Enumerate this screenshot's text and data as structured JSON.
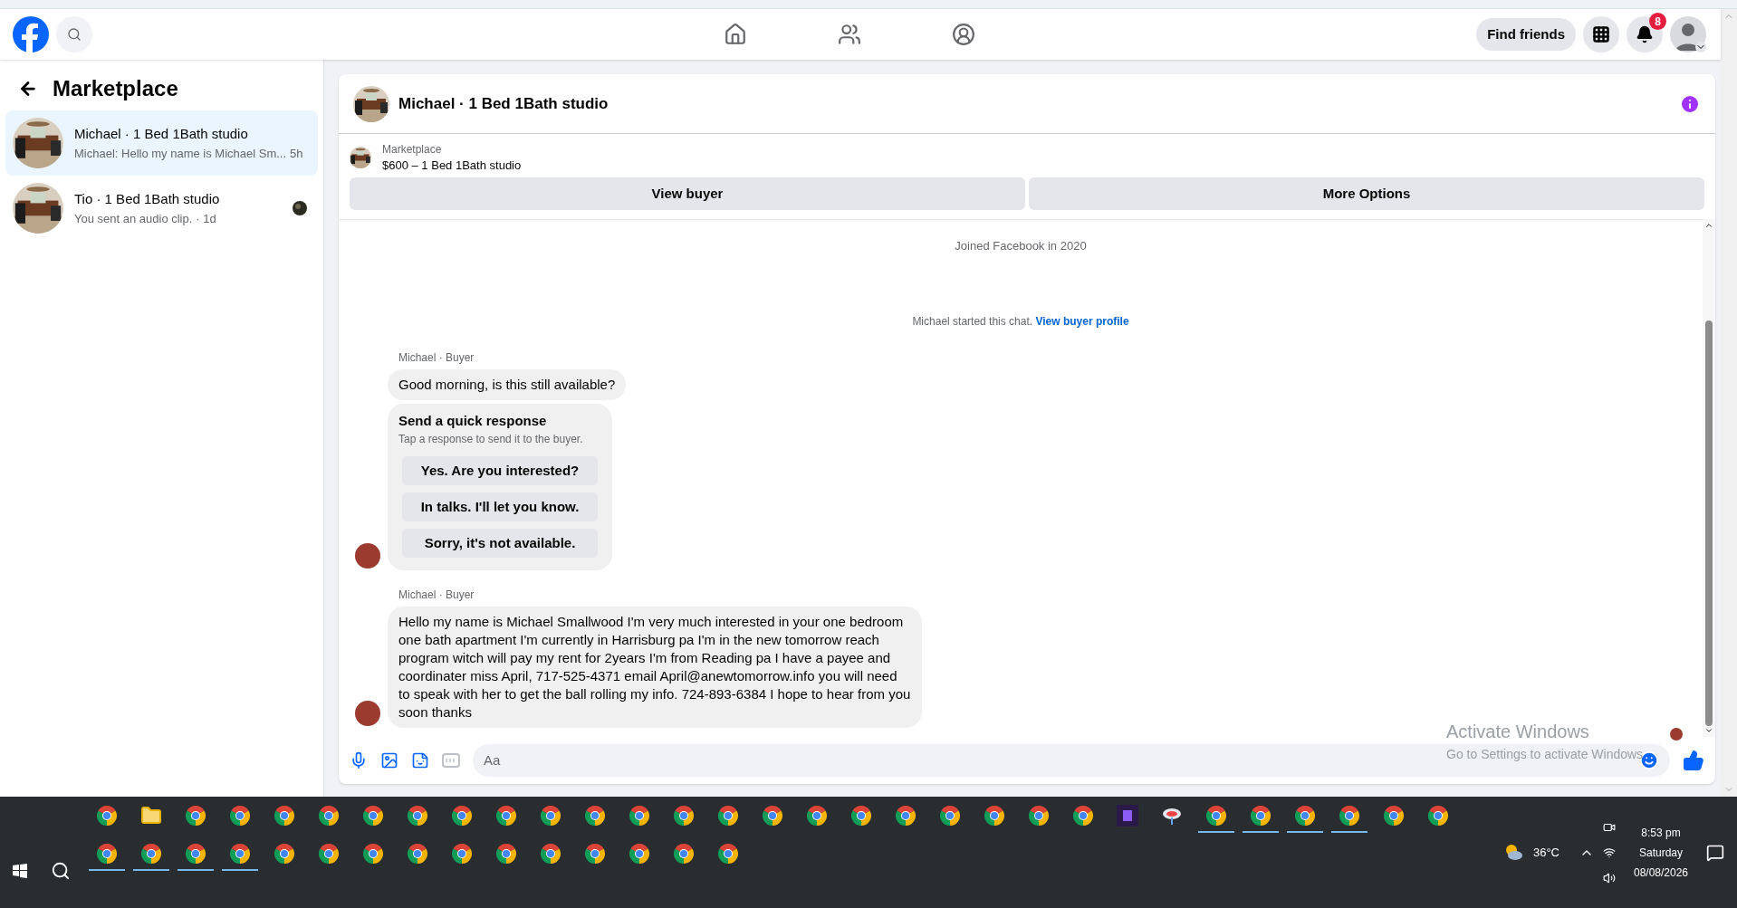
{
  "nav": {
    "find_friends": "Find friends",
    "notification_count": "8"
  },
  "sidebar": {
    "title": "Marketplace",
    "chats": [
      {
        "title": "Michael · 1 Bed 1Bath studio",
        "preview": "Michael: Hello my name is Michael Sm...",
        "time": "5h",
        "selected": true,
        "seen": false
      },
      {
        "title": "Tio · 1 Bed 1Bath studio",
        "preview": "You sent an audio clip.",
        "time": "· 1d",
        "selected": false,
        "seen": true
      }
    ]
  },
  "chat": {
    "title": "Michael · 1 Bed 1Bath studio",
    "listing": {
      "label": "Marketplace",
      "title": "$600 – 1 Bed 1Bath studio"
    },
    "buttons": [
      "View buyer",
      "More Options"
    ],
    "joined": "Joined Facebook in 2020",
    "started": "Michael started this chat.",
    "started_link": "View buyer profile",
    "groups": [
      {
        "sender": "Michael · Buyer",
        "items": [
          {
            "kind": "text",
            "text": "Good morning, is this still available?"
          },
          {
            "kind": "quick_responses",
            "title": "Send a quick response",
            "subtitle": "Tap a response to send it to the buyer.",
            "options": [
              "Yes. Are you interested?",
              "In talks. I'll let you know.",
              "Sorry, it's not available."
            ]
          }
        ]
      },
      {
        "sender": "Michael · Buyer",
        "items": [
          {
            "kind": "text",
            "text": "Hello my name is Michael Smallwood I'm very much interested in your one bedroom one bath apartment I'm currently in Harrisburg pa I'm in the new tomorrow reach program witch will pay my rent for 2years I'm from Reading pa I have a payee and coordinater miss April, 717-525-4371 email April@anewtomorrow.info you will need to speak with her to get the ball rolling my info. 724-893-6384 I hope to hear from you soon thanks"
          }
        ]
      }
    ],
    "composer": {
      "placeholder": "Aa"
    }
  },
  "watermark": {
    "title": "Activate Windows",
    "subtitle": "Go to Settings to activate Windows"
  },
  "taskbar": {
    "row1": [
      {
        "kind": "chrome",
        "running": false
      },
      {
        "kind": "folder",
        "running": false
      },
      {
        "kind": "chrome",
        "running": false
      },
      {
        "kind": "chrome",
        "running": false
      },
      {
        "kind": "chrome",
        "running": false
      },
      {
        "kind": "chrome",
        "running": false
      },
      {
        "kind": "chrome",
        "running": false
      },
      {
        "kind": "chrome",
        "running": false
      },
      {
        "kind": "chrome",
        "running": false
      },
      {
        "kind": "chrome",
        "running": false
      },
      {
        "kind": "chrome",
        "running": false
      },
      {
        "kind": "chrome",
        "running": false
      },
      {
        "kind": "chrome",
        "running": false
      },
      {
        "kind": "chrome",
        "running": false
      },
      {
        "kind": "chrome",
        "running": false
      },
      {
        "kind": "chrome",
        "running": false
      },
      {
        "kind": "chrome",
        "running": false
      },
      {
        "kind": "chrome",
        "running": false
      },
      {
        "kind": "chrome",
        "running": false
      },
      {
        "kind": "chrome",
        "running": false
      },
      {
        "kind": "chrome",
        "running": false
      },
      {
        "kind": "chrome",
        "running": false
      },
      {
        "kind": "chrome",
        "running": false
      },
      {
        "kind": "purple_app",
        "running": false
      },
      {
        "kind": "dish",
        "running": false
      },
      {
        "kind": "chrome",
        "running": true
      },
      {
        "kind": "chrome",
        "running": true
      },
      {
        "kind": "chrome",
        "running": true
      },
      {
        "kind": "chrome",
        "running": true
      },
      {
        "kind": "chrome",
        "running": false
      },
      {
        "kind": "chrome",
        "running": false
      }
    ],
    "row2": [
      {
        "kind": "chrome",
        "running": true
      },
      {
        "kind": "chrome",
        "running": true
      },
      {
        "kind": "chrome",
        "running": true
      },
      {
        "kind": "chrome",
        "running": true
      },
      {
        "kind": "chrome",
        "running": false
      },
      {
        "kind": "chrome",
        "running": false
      },
      {
        "kind": "chrome",
        "running": false
      },
      {
        "kind": "chrome",
        "running": false
      },
      {
        "kind": "chrome",
        "running": false
      },
      {
        "kind": "chrome",
        "running": false
      },
      {
        "kind": "chrome",
        "running": false
      },
      {
        "kind": "chrome",
        "running": false
      },
      {
        "kind": "chrome",
        "running": false
      },
      {
        "kind": "chrome",
        "running": false
      },
      {
        "kind": "chrome",
        "running": false
      }
    ],
    "weather": "36°C",
    "time": "8:53 pm",
    "day": "Saturday",
    "date": "08/08/2026"
  }
}
